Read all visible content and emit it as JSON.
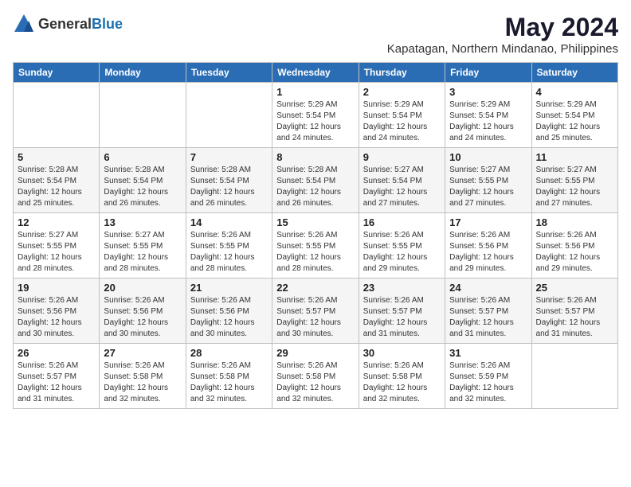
{
  "logo": {
    "general": "General",
    "blue": "Blue"
  },
  "header": {
    "month": "May 2024",
    "location": "Kapatagan, Northern Mindanao, Philippines"
  },
  "weekdays": [
    "Sunday",
    "Monday",
    "Tuesday",
    "Wednesday",
    "Thursday",
    "Friday",
    "Saturday"
  ],
  "weeks": [
    [
      {
        "day": "",
        "sunrise": "",
        "sunset": "",
        "daylight": ""
      },
      {
        "day": "",
        "sunrise": "",
        "sunset": "",
        "daylight": ""
      },
      {
        "day": "",
        "sunrise": "",
        "sunset": "",
        "daylight": ""
      },
      {
        "day": "1",
        "sunrise": "Sunrise: 5:29 AM",
        "sunset": "Sunset: 5:54 PM",
        "daylight": "Daylight: 12 hours and 24 minutes."
      },
      {
        "day": "2",
        "sunrise": "Sunrise: 5:29 AM",
        "sunset": "Sunset: 5:54 PM",
        "daylight": "Daylight: 12 hours and 24 minutes."
      },
      {
        "day": "3",
        "sunrise": "Sunrise: 5:29 AM",
        "sunset": "Sunset: 5:54 PM",
        "daylight": "Daylight: 12 hours and 24 minutes."
      },
      {
        "day": "4",
        "sunrise": "Sunrise: 5:29 AM",
        "sunset": "Sunset: 5:54 PM",
        "daylight": "Daylight: 12 hours and 25 minutes."
      }
    ],
    [
      {
        "day": "5",
        "sunrise": "Sunrise: 5:28 AM",
        "sunset": "Sunset: 5:54 PM",
        "daylight": "Daylight: 12 hours and 25 minutes."
      },
      {
        "day": "6",
        "sunrise": "Sunrise: 5:28 AM",
        "sunset": "Sunset: 5:54 PM",
        "daylight": "Daylight: 12 hours and 26 minutes."
      },
      {
        "day": "7",
        "sunrise": "Sunrise: 5:28 AM",
        "sunset": "Sunset: 5:54 PM",
        "daylight": "Daylight: 12 hours and 26 minutes."
      },
      {
        "day": "8",
        "sunrise": "Sunrise: 5:28 AM",
        "sunset": "Sunset: 5:54 PM",
        "daylight": "Daylight: 12 hours and 26 minutes."
      },
      {
        "day": "9",
        "sunrise": "Sunrise: 5:27 AM",
        "sunset": "Sunset: 5:54 PM",
        "daylight": "Daylight: 12 hours and 27 minutes."
      },
      {
        "day": "10",
        "sunrise": "Sunrise: 5:27 AM",
        "sunset": "Sunset: 5:55 PM",
        "daylight": "Daylight: 12 hours and 27 minutes."
      },
      {
        "day": "11",
        "sunrise": "Sunrise: 5:27 AM",
        "sunset": "Sunset: 5:55 PM",
        "daylight": "Daylight: 12 hours and 27 minutes."
      }
    ],
    [
      {
        "day": "12",
        "sunrise": "Sunrise: 5:27 AM",
        "sunset": "Sunset: 5:55 PM",
        "daylight": "Daylight: 12 hours and 28 minutes."
      },
      {
        "day": "13",
        "sunrise": "Sunrise: 5:27 AM",
        "sunset": "Sunset: 5:55 PM",
        "daylight": "Daylight: 12 hours and 28 minutes."
      },
      {
        "day": "14",
        "sunrise": "Sunrise: 5:26 AM",
        "sunset": "Sunset: 5:55 PM",
        "daylight": "Daylight: 12 hours and 28 minutes."
      },
      {
        "day": "15",
        "sunrise": "Sunrise: 5:26 AM",
        "sunset": "Sunset: 5:55 PM",
        "daylight": "Daylight: 12 hours and 28 minutes."
      },
      {
        "day": "16",
        "sunrise": "Sunrise: 5:26 AM",
        "sunset": "Sunset: 5:55 PM",
        "daylight": "Daylight: 12 hours and 29 minutes."
      },
      {
        "day": "17",
        "sunrise": "Sunrise: 5:26 AM",
        "sunset": "Sunset: 5:56 PM",
        "daylight": "Daylight: 12 hours and 29 minutes."
      },
      {
        "day": "18",
        "sunrise": "Sunrise: 5:26 AM",
        "sunset": "Sunset: 5:56 PM",
        "daylight": "Daylight: 12 hours and 29 minutes."
      }
    ],
    [
      {
        "day": "19",
        "sunrise": "Sunrise: 5:26 AM",
        "sunset": "Sunset: 5:56 PM",
        "daylight": "Daylight: 12 hours and 30 minutes."
      },
      {
        "day": "20",
        "sunrise": "Sunrise: 5:26 AM",
        "sunset": "Sunset: 5:56 PM",
        "daylight": "Daylight: 12 hours and 30 minutes."
      },
      {
        "day": "21",
        "sunrise": "Sunrise: 5:26 AM",
        "sunset": "Sunset: 5:56 PM",
        "daylight": "Daylight: 12 hours and 30 minutes."
      },
      {
        "day": "22",
        "sunrise": "Sunrise: 5:26 AM",
        "sunset": "Sunset: 5:57 PM",
        "daylight": "Daylight: 12 hours and 30 minutes."
      },
      {
        "day": "23",
        "sunrise": "Sunrise: 5:26 AM",
        "sunset": "Sunset: 5:57 PM",
        "daylight": "Daylight: 12 hours and 31 minutes."
      },
      {
        "day": "24",
        "sunrise": "Sunrise: 5:26 AM",
        "sunset": "Sunset: 5:57 PM",
        "daylight": "Daylight: 12 hours and 31 minutes."
      },
      {
        "day": "25",
        "sunrise": "Sunrise: 5:26 AM",
        "sunset": "Sunset: 5:57 PM",
        "daylight": "Daylight: 12 hours and 31 minutes."
      }
    ],
    [
      {
        "day": "26",
        "sunrise": "Sunrise: 5:26 AM",
        "sunset": "Sunset: 5:57 PM",
        "daylight": "Daylight: 12 hours and 31 minutes."
      },
      {
        "day": "27",
        "sunrise": "Sunrise: 5:26 AM",
        "sunset": "Sunset: 5:58 PM",
        "daylight": "Daylight: 12 hours and 32 minutes."
      },
      {
        "day": "28",
        "sunrise": "Sunrise: 5:26 AM",
        "sunset": "Sunset: 5:58 PM",
        "daylight": "Daylight: 12 hours and 32 minutes."
      },
      {
        "day": "29",
        "sunrise": "Sunrise: 5:26 AM",
        "sunset": "Sunset: 5:58 PM",
        "daylight": "Daylight: 12 hours and 32 minutes."
      },
      {
        "day": "30",
        "sunrise": "Sunrise: 5:26 AM",
        "sunset": "Sunset: 5:58 PM",
        "daylight": "Daylight: 12 hours and 32 minutes."
      },
      {
        "day": "31",
        "sunrise": "Sunrise: 5:26 AM",
        "sunset": "Sunset: 5:59 PM",
        "daylight": "Daylight: 12 hours and 32 minutes."
      },
      {
        "day": "",
        "sunrise": "",
        "sunset": "",
        "daylight": ""
      }
    ]
  ]
}
